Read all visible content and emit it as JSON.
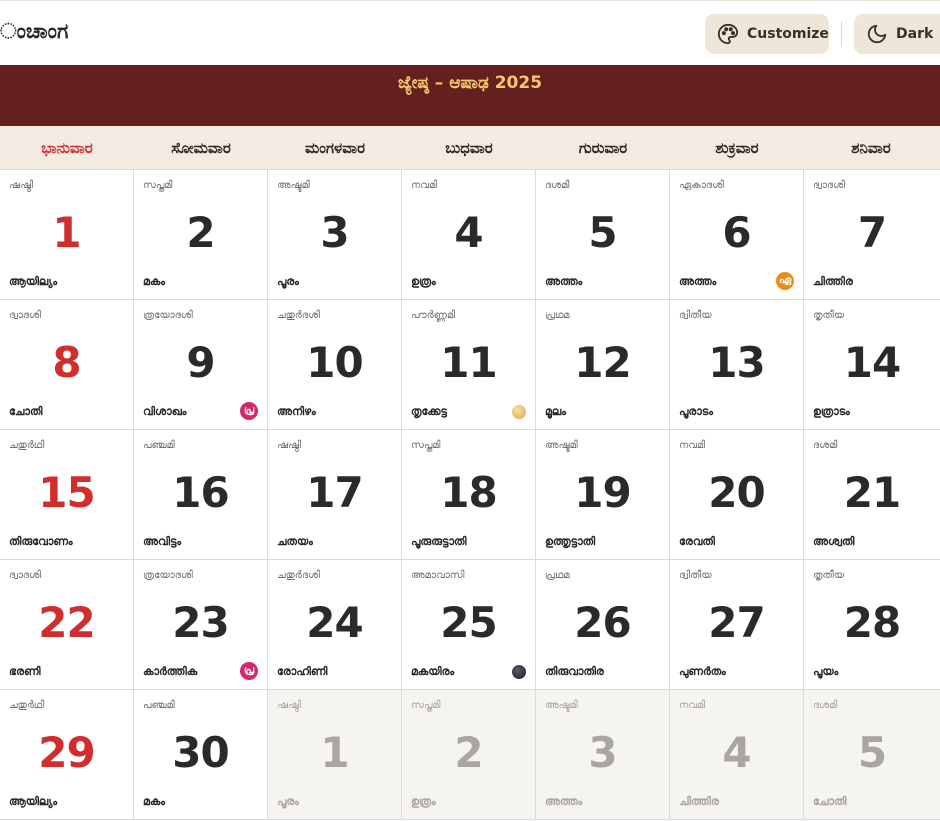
{
  "app": {
    "title": "ಂಚಾಂಗ"
  },
  "toolbar": {
    "customize_label": "Customize",
    "dark_label": "Dark"
  },
  "calendar": {
    "month_title": "ಜ್ಯೇಷ್ಠ – ಆಷಾಢ 2025",
    "weekdays": [
      "ಭಾನುವಾರ",
      "ಸೋಮವಾರ",
      "ಮಂಗಳವಾರ",
      "ಬುಧವಾರ",
      "ಗುರುವಾರ",
      "ಶುಕ್ರವಾರ",
      "ಶನಿವಾರ"
    ],
    "weeks": [
      [
        {
          "day": "1",
          "tithi": "ഷഷ്ഠി",
          "star": "ആയില്യം",
          "sunday": true
        },
        {
          "day": "2",
          "tithi": "സപ്തമി",
          "star": "മകം"
        },
        {
          "day": "3",
          "tithi": "അഷ്ടമി",
          "star": "പൂരം"
        },
        {
          "day": "4",
          "tithi": "നവമി",
          "star": "ഉത്രം"
        },
        {
          "day": "5",
          "tithi": "ദശമി",
          "star": "അത്തം"
        },
        {
          "day": "6",
          "tithi": "ഏകാദശി",
          "star": "അത്തം",
          "badge": "ഏ",
          "badge_color": "orange"
        },
        {
          "day": "7",
          "tithi": "ദ്വാദശി",
          "star": "ചിത്തിര"
        }
      ],
      [
        {
          "day": "8",
          "tithi": "ദ്വാദശി",
          "star": "ചോതി",
          "sunday": true
        },
        {
          "day": "9",
          "tithi": "ത്രയോദശി",
          "star": "വിശാഖം",
          "badge": "പ്ര",
          "badge_color": "pink"
        },
        {
          "day": "10",
          "tithi": "ചതുർദശി",
          "star": "അനിഴം"
        },
        {
          "day": "11",
          "tithi": "പൗർണ്ണമി",
          "star": "തൃക്കേട്ട",
          "moon": "full"
        },
        {
          "day": "12",
          "tithi": "പ്രഥമ",
          "star": "മൂലം"
        },
        {
          "day": "13",
          "tithi": "ദ്വിതീയ",
          "star": "പൂരാടം"
        },
        {
          "day": "14",
          "tithi": "തൃതീയ",
          "star": "ഉത്രാടം"
        }
      ],
      [
        {
          "day": "15",
          "tithi": "ചതുർഥി",
          "star": "തിരുവോണം",
          "sunday": true
        },
        {
          "day": "16",
          "tithi": "പഞ്ചമി",
          "star": "അവിട്ടം"
        },
        {
          "day": "17",
          "tithi": "ഷഷ്ഠി",
          "star": "ചതയം"
        },
        {
          "day": "18",
          "tithi": "സപ്തമി",
          "star": "പൂരുരുട്ടാതി"
        },
        {
          "day": "19",
          "tithi": "അഷ്ടമി",
          "star": "ഉത്തൃട്ടാതി"
        },
        {
          "day": "20",
          "tithi": "നവമി",
          "star": "രേവതി"
        },
        {
          "day": "21",
          "tithi": "ദശമി",
          "star": "അശ്വതി"
        }
      ],
      [
        {
          "day": "22",
          "tithi": "ദ്വാദശി",
          "star": "ഭരണി",
          "sunday": true
        },
        {
          "day": "23",
          "tithi": "ത്രയോദശി",
          "star": "കാർത്തിക",
          "badge": "പ്ര",
          "badge_color": "pink"
        },
        {
          "day": "24",
          "tithi": "ചതുർദശി",
          "star": "രോഹിണി"
        },
        {
          "day": "25",
          "tithi": "അമാവാസി",
          "star": "മകയിരം",
          "moon": "new"
        },
        {
          "day": "26",
          "tithi": "പ്രഥമ",
          "star": "തിരുവാതിര"
        },
        {
          "day": "27",
          "tithi": "ദ്വിതീയ",
          "star": "പുണർതം"
        },
        {
          "day": "28",
          "tithi": "തൃതീയ",
          "star": "പൂയം"
        }
      ],
      [
        {
          "day": "29",
          "tithi": "ചതുർഥി",
          "star": "ആയില്യം",
          "sunday": true
        },
        {
          "day": "30",
          "tithi": "പഞ്ചമി",
          "star": "മകം"
        },
        {
          "day": "1",
          "tithi": "ഷഷ്ഠി",
          "star": "പൂരം",
          "other": true
        },
        {
          "day": "2",
          "tithi": "സപ്തമി",
          "star": "ഉത്രം",
          "other": true
        },
        {
          "day": "3",
          "tithi": "അഷ്ടമി",
          "star": "അത്തം",
          "other": true
        },
        {
          "day": "4",
          "tithi": "നവമി",
          "star": "ചിത്തിര",
          "other": true
        },
        {
          "day": "5",
          "tithi": "ദശമി",
          "star": "ചോതി",
          "other": true
        }
      ]
    ]
  }
}
